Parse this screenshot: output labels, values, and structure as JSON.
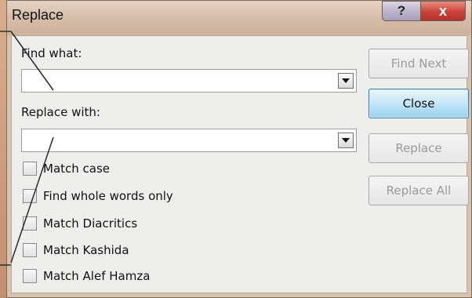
{
  "window": {
    "title": "Replace",
    "help_button": "?",
    "close_button": "x"
  },
  "find": {
    "label": "Find what:",
    "value": ""
  },
  "replace": {
    "label": "Replace with:",
    "value": ""
  },
  "options": [
    {
      "label": "Match case",
      "checked": false
    },
    {
      "label": "Find whole words only",
      "checked": false
    },
    {
      "label": "Match Diacritics",
      "checked": false
    },
    {
      "label": "Match Kashida",
      "checked": false
    },
    {
      "label": "Match Alef Hamza",
      "checked": false
    }
  ],
  "buttons": {
    "find_next": "Find Next",
    "close": "Close",
    "replace": "Replace",
    "replace_all": "Replace All"
  },
  "colors": {
    "primary_button_border": "#3c7fb1",
    "close_x": "#c9423a"
  }
}
